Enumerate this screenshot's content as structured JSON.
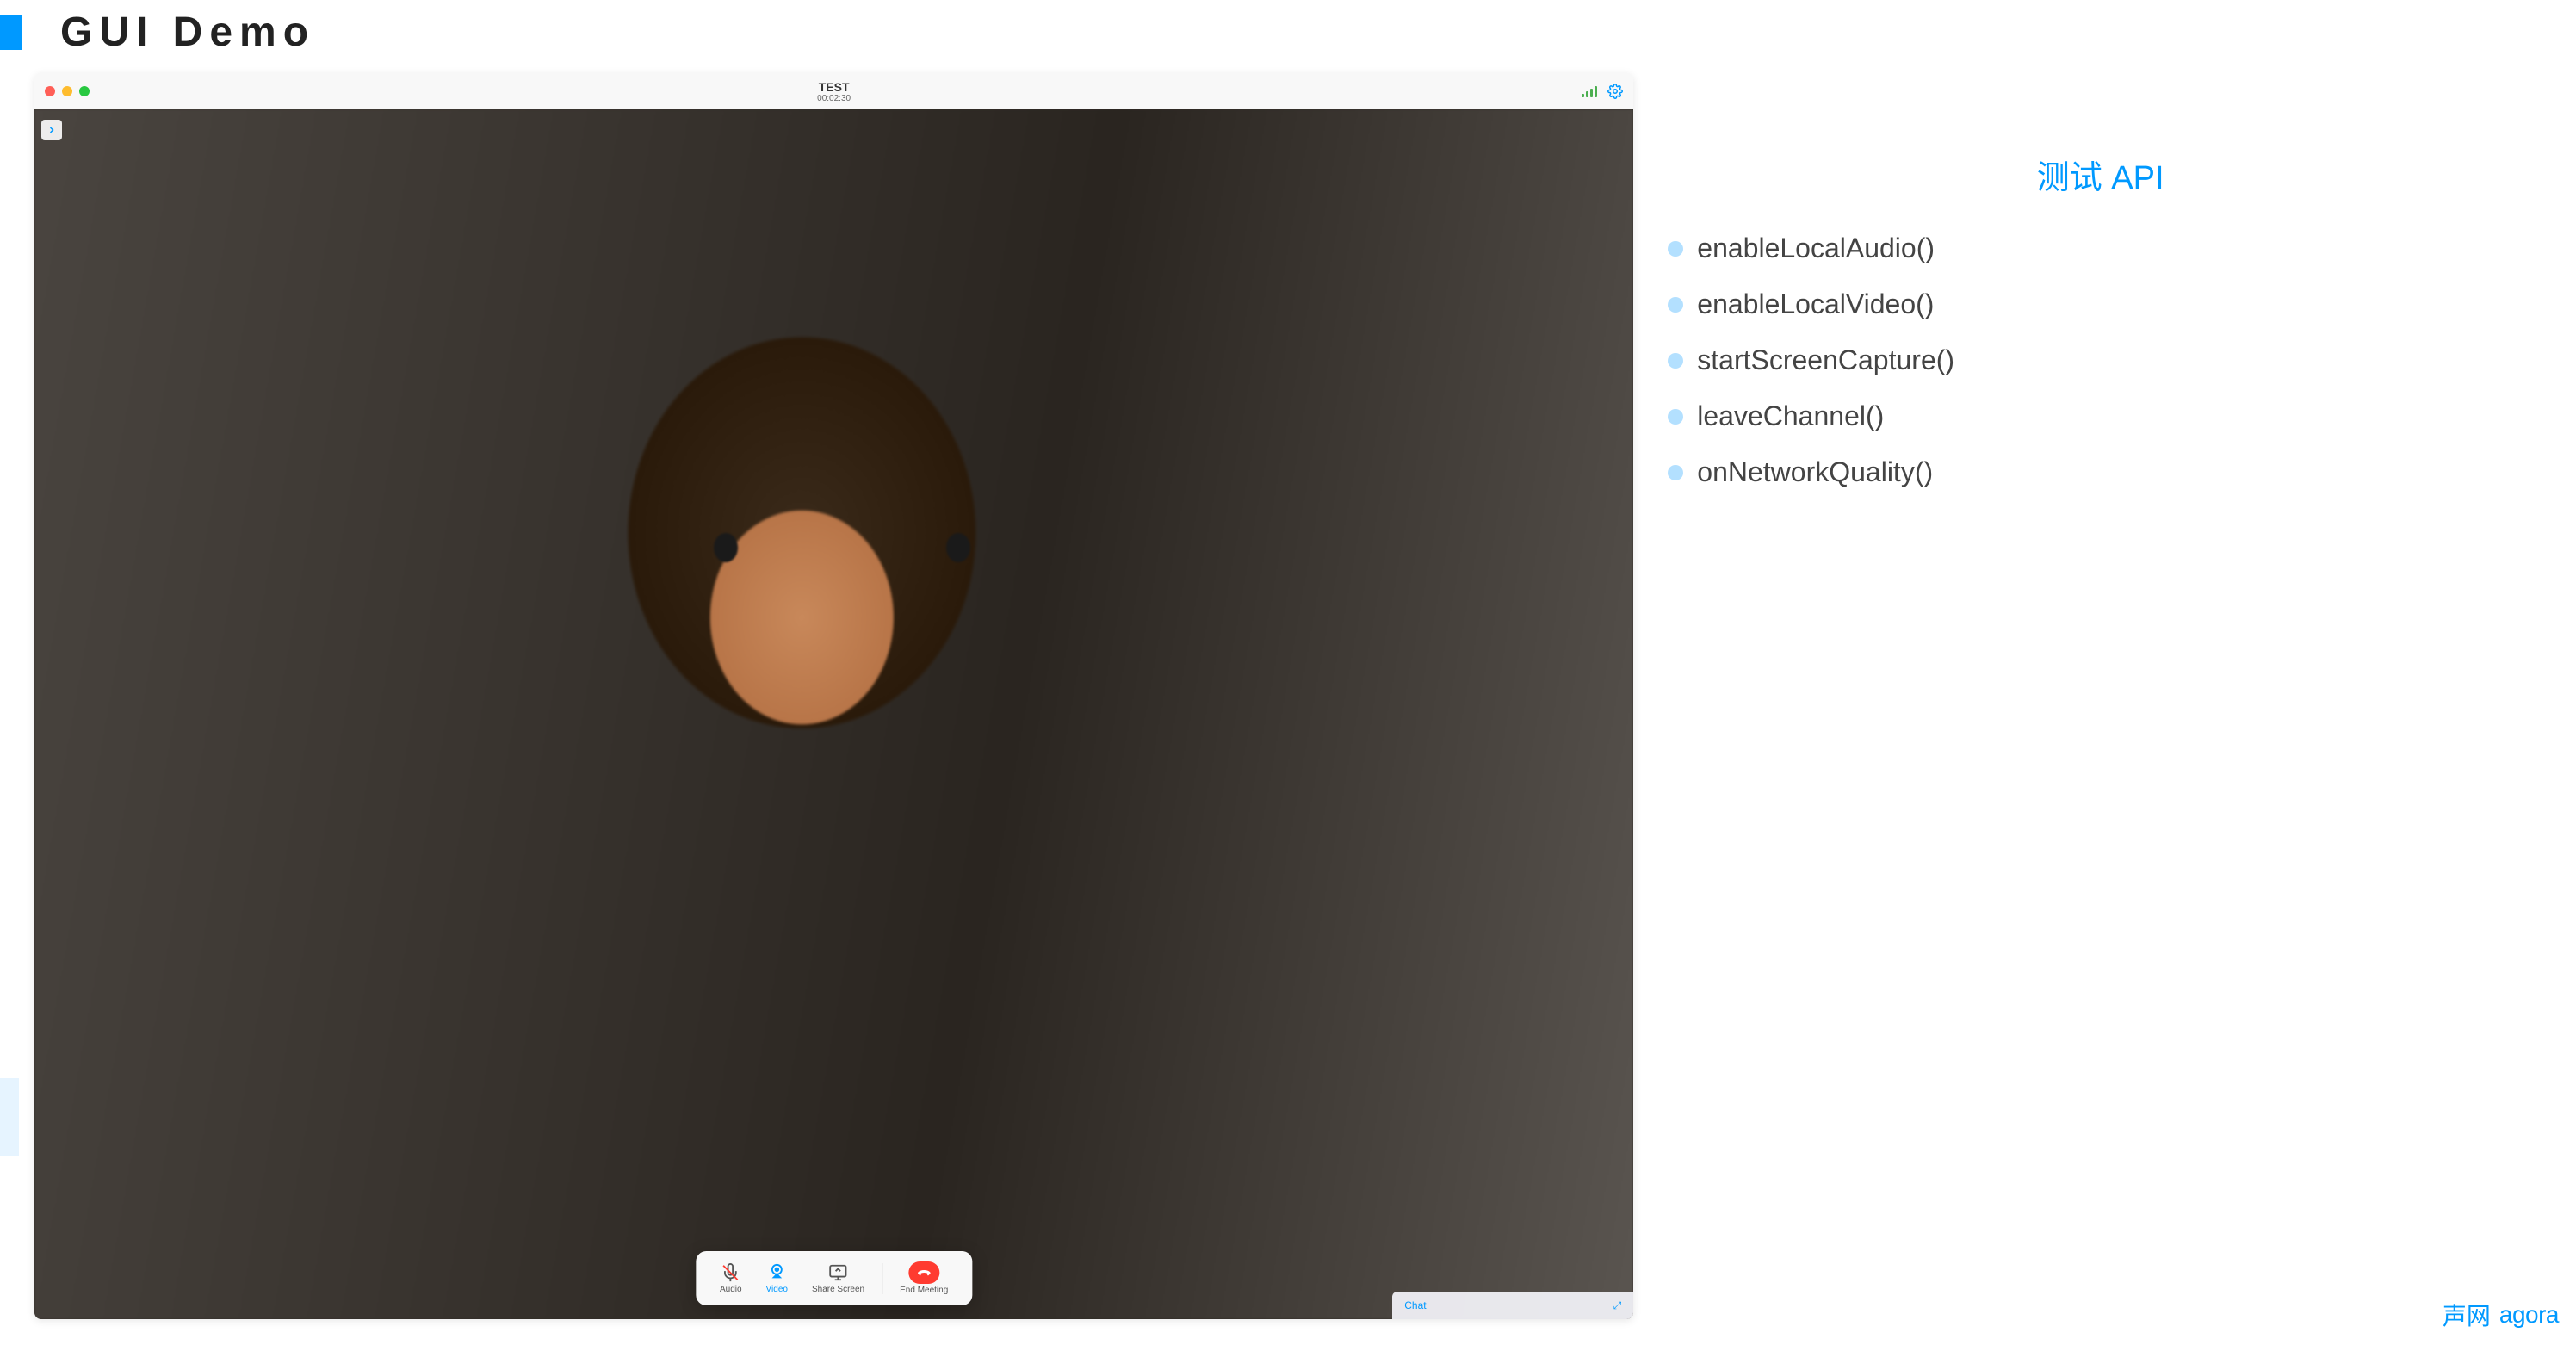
{
  "slide": {
    "title": "GUI Demo"
  },
  "window": {
    "title": "TEST",
    "timer": "00:02:30"
  },
  "controls": {
    "audio": "Audio",
    "video": "Video",
    "share_screen": "Share Screen",
    "end_meeting": "End Meeting"
  },
  "chat": {
    "label": "Chat"
  },
  "api_panel": {
    "title": "测试 API",
    "items": [
      "enableLocalAudio()",
      "enableLocalVideo()",
      "startScreenCapture()",
      "leaveChannel()",
      "onNetworkQuality()"
    ]
  },
  "footer": {
    "logo_cn": "声网",
    "logo_en": "agora"
  }
}
